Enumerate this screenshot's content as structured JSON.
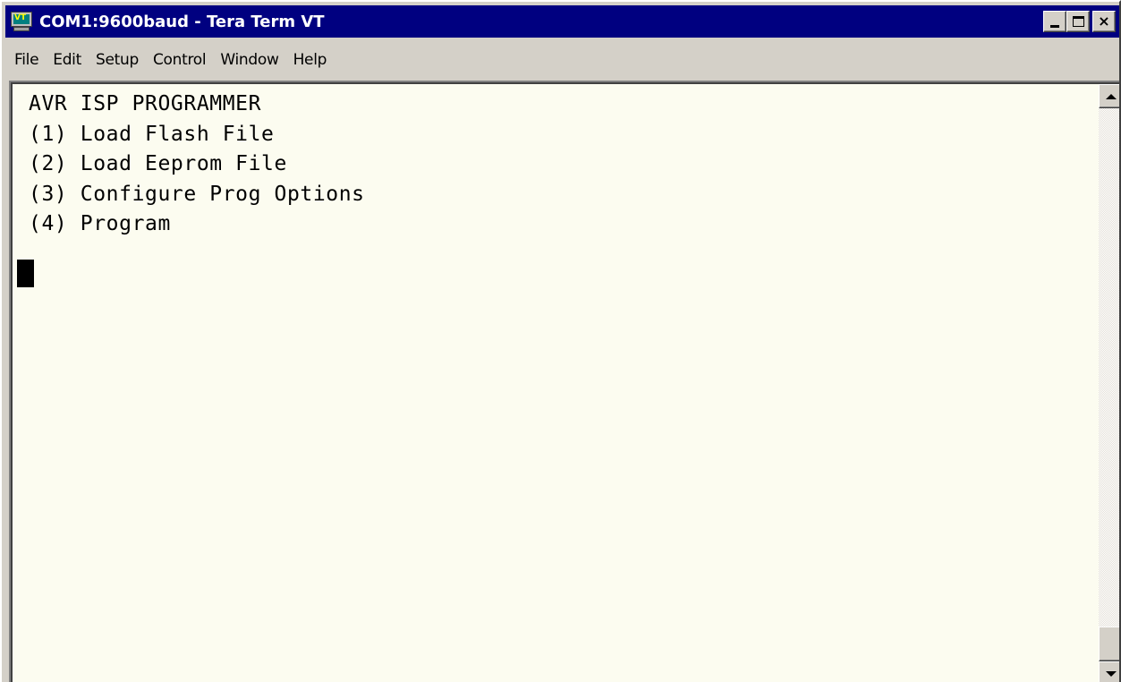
{
  "window": {
    "title": "COM1:9600baud - Tera Term VT",
    "app_icon": "tera-term-vt-icon",
    "title_bar_color": "#000080",
    "controls": {
      "minimize_icon": "minimize-icon",
      "maximize_icon": "maximize-icon",
      "close_icon": "close-icon",
      "close_glyph": "×"
    }
  },
  "menu": {
    "items": [
      {
        "label": "File"
      },
      {
        "label": "Edit"
      },
      {
        "label": "Setup"
      },
      {
        "label": "Control"
      },
      {
        "label": "Window"
      },
      {
        "label": "Help"
      }
    ]
  },
  "terminal": {
    "background": "#fcfcf0",
    "lines": [
      "AVR ISP PROGRAMMER",
      "(1) Load Flash File",
      "(2) Load Eeprom File",
      "(3) Configure Prog Options",
      "(4) Program"
    ]
  },
  "scrollbar": {
    "up_icon": "scroll-up-arrow-icon",
    "down_icon": "scroll-down-arrow-icon"
  }
}
